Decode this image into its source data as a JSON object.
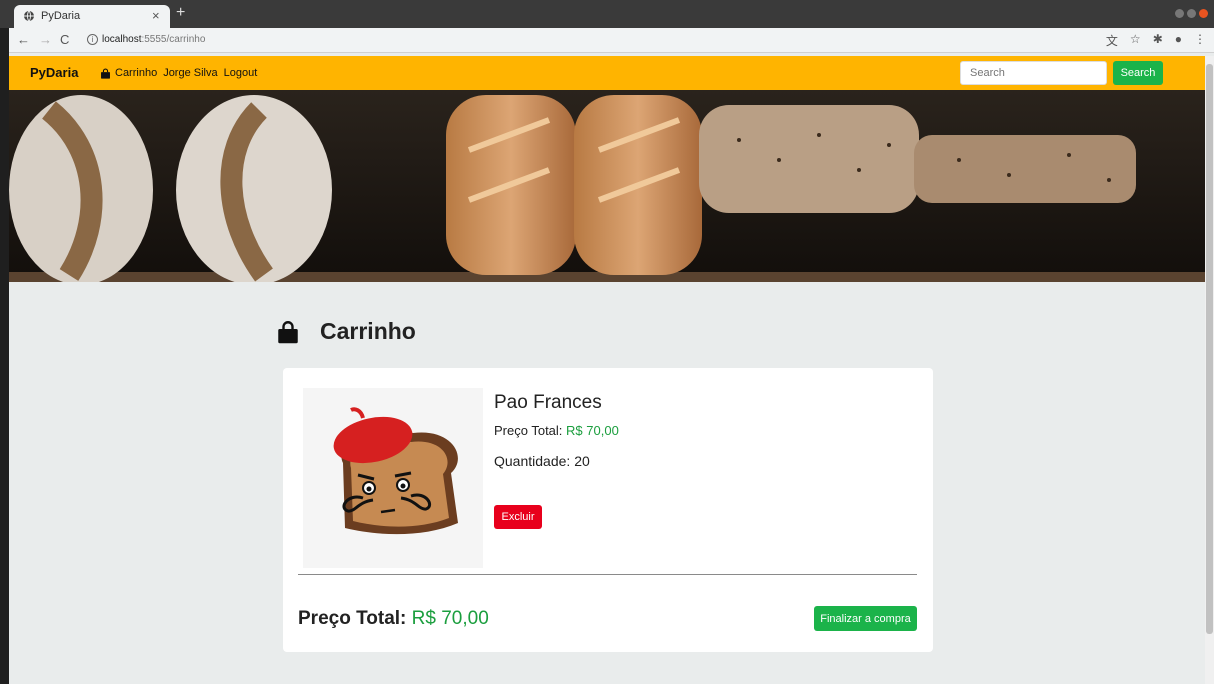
{
  "browser": {
    "tab_title": "PyDaria",
    "tab_close": "×",
    "new_tab": "+",
    "url_host": "localhost",
    "url_path": ":5555/carrinho"
  },
  "navbar": {
    "brand": "PyDaria",
    "cart_link": "Carrinho",
    "user_link": "Jorge Silva",
    "logout_link": "Logout",
    "search_placeholder": "Search",
    "search_button": "Search"
  },
  "page": {
    "title": "Carrinho"
  },
  "cart": {
    "items": [
      {
        "name": "Pao Frances",
        "price_label": "Preço Total:",
        "price_value": "R$ 70,00",
        "quantity_label": "Quantidade:",
        "quantity_value": "20",
        "delete_button": "Excluir",
        "image_icon": "french-bread-mascot-icon"
      }
    ],
    "total_label": "Preço Total:",
    "total_value": "R$ 70,00",
    "checkout_button": "Finalizar a compra"
  },
  "colors": {
    "navbar": "#ffb400",
    "success": "#1bb34a",
    "danger": "#e8001c",
    "price_green": "#1b9e3e"
  }
}
